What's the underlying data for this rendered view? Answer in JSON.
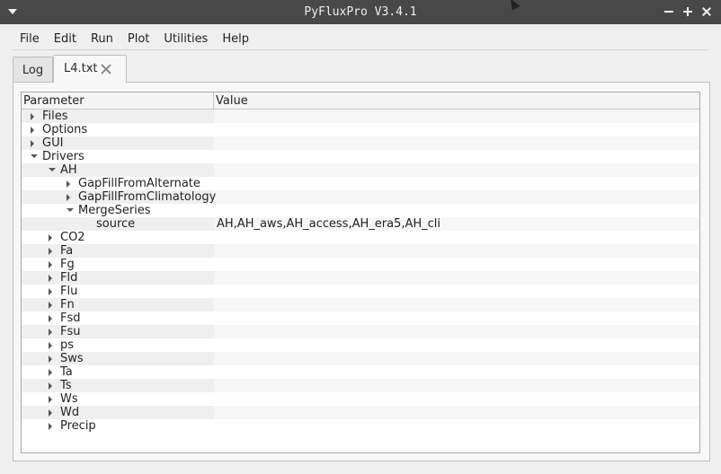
{
  "window": {
    "title": "PyFluxPro V3.4.1"
  },
  "menubar": {
    "items": [
      "File",
      "Edit",
      "Run",
      "Plot",
      "Utilities",
      "Help"
    ]
  },
  "tabs": [
    {
      "label": "Log",
      "active": false
    },
    {
      "label": "L4.txt",
      "active": true
    }
  ],
  "tree": {
    "columns": [
      "Parameter",
      "Value"
    ],
    "rows": [
      {
        "label": "Files",
        "depth": 0,
        "state": "collapsed",
        "value": ""
      },
      {
        "label": "Options",
        "depth": 0,
        "state": "collapsed",
        "value": ""
      },
      {
        "label": "GUI",
        "depth": 0,
        "state": "collapsed",
        "value": ""
      },
      {
        "label": "Drivers",
        "depth": 0,
        "state": "expanded",
        "value": ""
      },
      {
        "label": "AH",
        "depth": 1,
        "state": "expanded",
        "value": ""
      },
      {
        "label": "GapFillFromAlternate",
        "depth": 2,
        "state": "collapsed",
        "value": ""
      },
      {
        "label": "GapFillFromClimatology",
        "depth": 2,
        "state": "collapsed",
        "value": ""
      },
      {
        "label": "MergeSeries",
        "depth": 2,
        "state": "expanded",
        "value": ""
      },
      {
        "label": "source",
        "depth": 3,
        "state": "leaf",
        "value": "AH,AH_aws,AH_access,AH_era5,AH_cli"
      },
      {
        "label": "CO2",
        "depth": 1,
        "state": "collapsed",
        "value": ""
      },
      {
        "label": "Fa",
        "depth": 1,
        "state": "collapsed",
        "value": ""
      },
      {
        "label": "Fg",
        "depth": 1,
        "state": "collapsed",
        "value": ""
      },
      {
        "label": "Fld",
        "depth": 1,
        "state": "collapsed",
        "value": ""
      },
      {
        "label": "Flu",
        "depth": 1,
        "state": "collapsed",
        "value": ""
      },
      {
        "label": "Fn",
        "depth": 1,
        "state": "collapsed",
        "value": ""
      },
      {
        "label": "Fsd",
        "depth": 1,
        "state": "collapsed",
        "value": ""
      },
      {
        "label": "Fsu",
        "depth": 1,
        "state": "collapsed",
        "value": ""
      },
      {
        "label": "ps",
        "depth": 1,
        "state": "collapsed",
        "value": ""
      },
      {
        "label": "Sws",
        "depth": 1,
        "state": "collapsed",
        "value": ""
      },
      {
        "label": "Ta",
        "depth": 1,
        "state": "collapsed",
        "value": ""
      },
      {
        "label": "Ts",
        "depth": 1,
        "state": "collapsed",
        "value": ""
      },
      {
        "label": "Ws",
        "depth": 1,
        "state": "collapsed",
        "value": ""
      },
      {
        "label": "Wd",
        "depth": 1,
        "state": "collapsed",
        "value": ""
      },
      {
        "label": "Precip",
        "depth": 1,
        "state": "collapsed",
        "value": ""
      }
    ]
  }
}
